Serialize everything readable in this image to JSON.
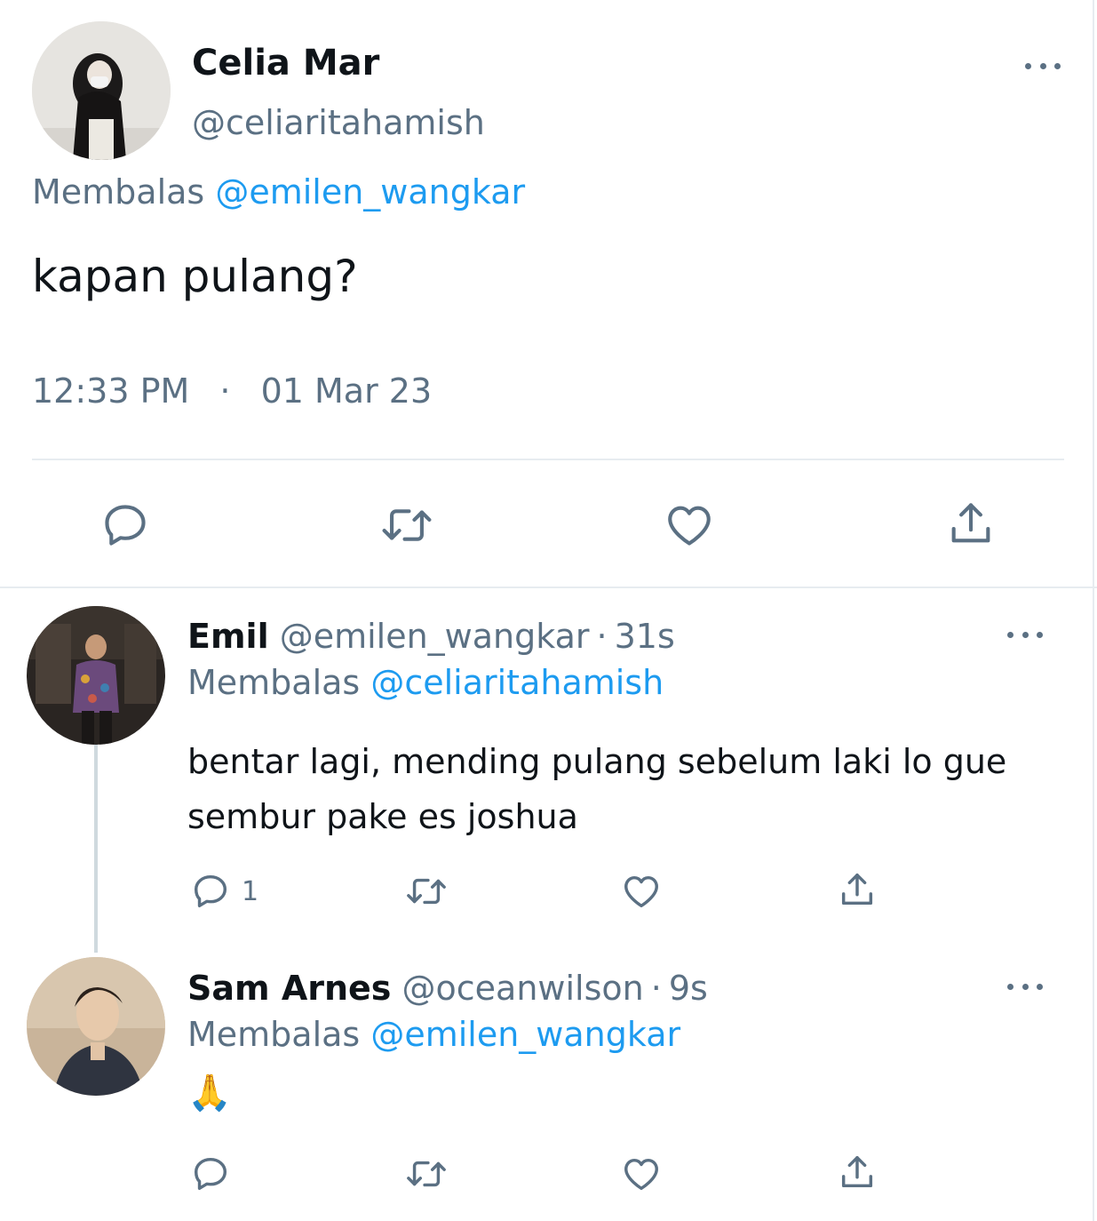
{
  "main_tweet": {
    "name": "Celia Mar",
    "handle": "@celiaritahamish",
    "reply_prefix": "Membalas",
    "reply_to": "@emilen_wangkar",
    "text": "kapan pulang?",
    "time": "12:33 PM",
    "separator": "·",
    "date": "01 Mar 23"
  },
  "replies": [
    {
      "name": "Emil",
      "handle": "@emilen_wangkar",
      "dot": "·",
      "age": "31s",
      "reply_prefix": "Membalas",
      "reply_to": "@celiaritahamish",
      "text_line1": "bentar lagi, mending pulang sebelum laki lo gue",
      "text_line2": "sembur pake es joshua",
      "reply_count": "1"
    },
    {
      "name": "Sam Arnes",
      "handle": "@oceanwilson",
      "dot": "·",
      "age": "9s",
      "reply_prefix": "Membalas",
      "reply_to": "@emilen_wangkar",
      "text": "🙏"
    }
  ],
  "colors": {
    "accent": "#1d9bf0",
    "muted": "#5b7083",
    "text": "#0f1419",
    "divider": "#e7ecf0"
  }
}
